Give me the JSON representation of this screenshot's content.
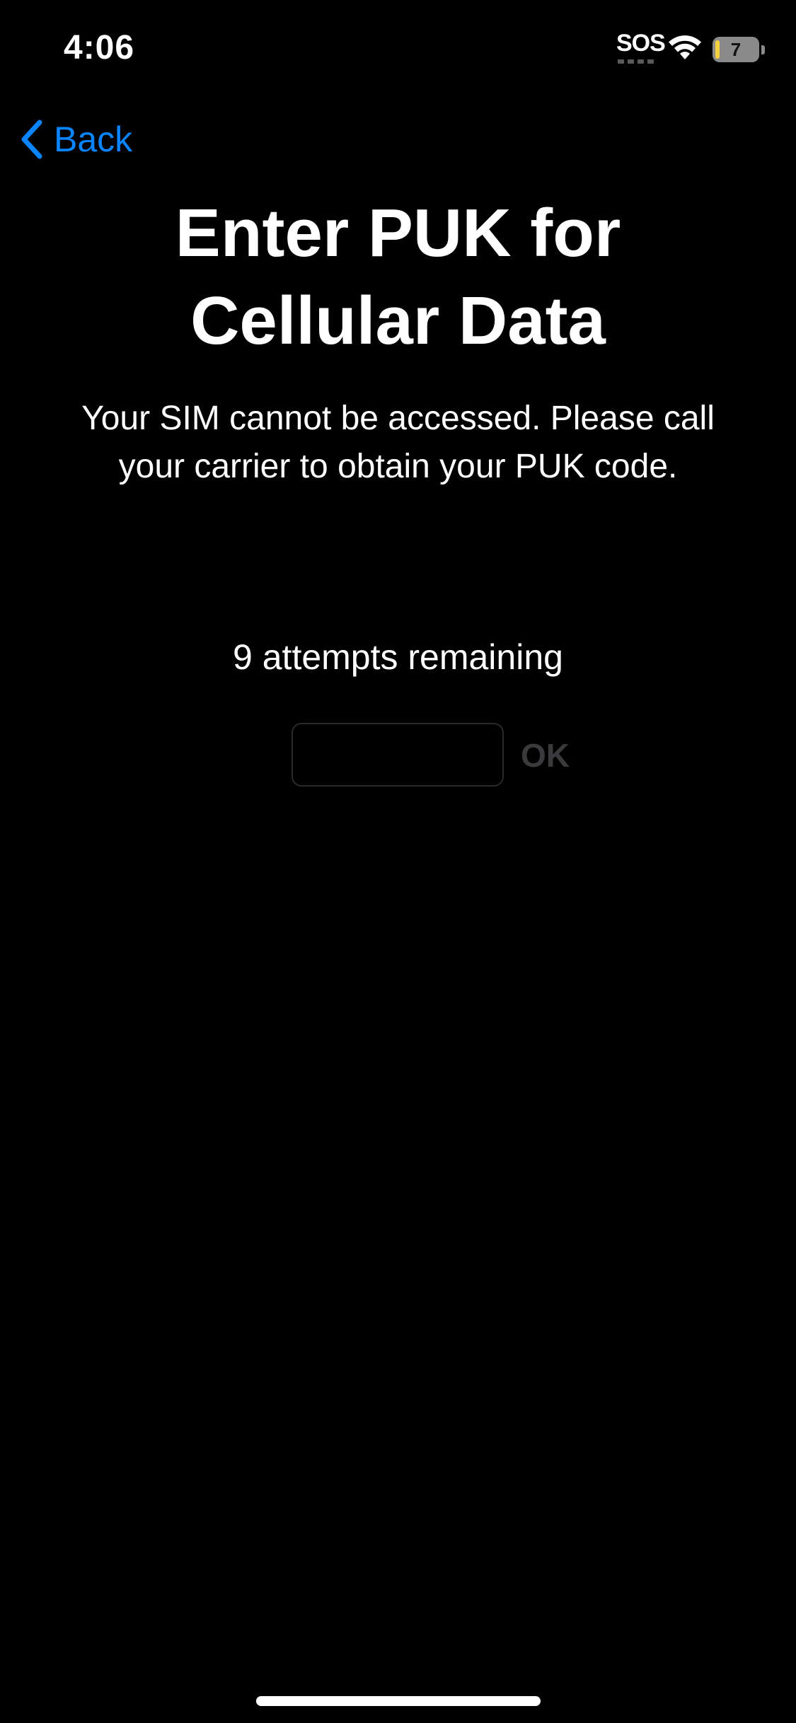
{
  "status_bar": {
    "time": "4:06",
    "carrier_status": "SOS",
    "battery_level": "7",
    "icons": [
      "sos-indicator",
      "wifi-icon",
      "battery-icon"
    ],
    "battery_fill_color": "#f4d03f"
  },
  "nav": {
    "back_label": "Back",
    "back_icon": "chevron-left-icon",
    "accent_color": "#0a84ff"
  },
  "main": {
    "title_line1": "Enter PUK for",
    "title_line2": "Cellular Data",
    "description_line1": "Your SIM cannot be accessed. Please call",
    "description_line2": "your carrier to obtain your PUK code.",
    "attempts": "9 attempts remaining",
    "puk_input_value": "",
    "ok_label": "OK"
  }
}
